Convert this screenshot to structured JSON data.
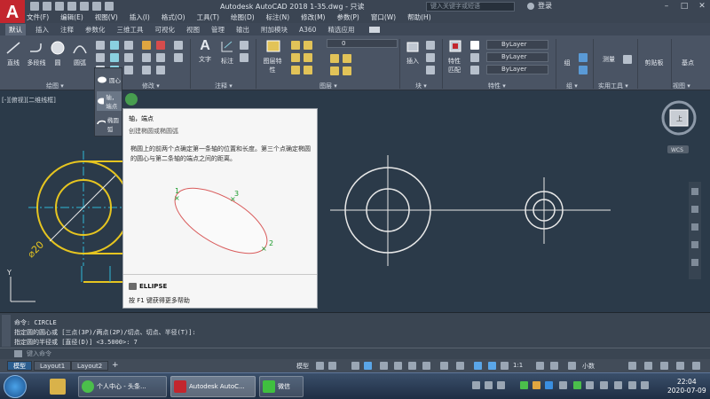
{
  "titlebar": {
    "title": "Autodesk AutoCAD 2018    1-35.dwg - 只读",
    "search_placeholder": "键入关键字或短语",
    "login_label": "登录"
  },
  "menubar": [
    "文件(F)",
    "编辑(E)",
    "视图(V)",
    "插入(I)",
    "格式(O)",
    "工具(T)",
    "绘图(D)",
    "标注(N)",
    "修改(M)",
    "参数(P)",
    "窗口(W)",
    "帮助(H)"
  ],
  "ribbon_tabs": [
    "默认",
    "插入",
    "注释",
    "参数化",
    "三维工具",
    "可视化",
    "视图",
    "管理",
    "输出",
    "附加模块",
    "A360",
    "精选应用"
  ],
  "ribbon": {
    "tools": {
      "line": "直线",
      "polyline": "多段线",
      "circle": "圆",
      "arc": "圆弧",
      "text": "文字",
      "dimension": "标注",
      "layer_props": "图层特性",
      "insert": "插入",
      "match_props": "特性匹配",
      "group": "组",
      "measure": "测量",
      "paste": "剪贴板",
      "base": "基点"
    },
    "panels": {
      "draw": "绘图 ▾",
      "modify": "修改 ▾",
      "annotation": "注释 ▾",
      "layers": "图层 ▾",
      "block": "块 ▾",
      "properties": "特性 ▾",
      "groups": "组 ▾",
      "utilities": "实用工具 ▾",
      "view": "视图 ▾"
    },
    "layer_value": "0",
    "bylayer": [
      "ByLayer",
      "ByLayer",
      "ByLayer"
    ]
  },
  "circle_dropdown": {
    "items": [
      "圆心",
      "轴，端点",
      "椭圆弧"
    ]
  },
  "viewport_label": "[-][俯视][二维线框]",
  "tooltip": {
    "title": "轴，端点",
    "subtitle": "创建椭圆或椭圆弧",
    "description": "椭圆上的前两个点确定第一条轴的位置和长度。第三个点确定椭圆的圆心与第二条轴的端点之间的距离。",
    "point_labels": [
      "1",
      "3",
      "2"
    ],
    "command": "ELLIPSE",
    "help": "按 F1 键获得更多帮助"
  },
  "drawing": {
    "dimension_label": "⌀20",
    "y_axis_label": "Y",
    "viewcube_label": "上",
    "wcs_label": "WCS"
  },
  "command_history": [
    "命令:  CIRCLE",
    "指定圆的圆心或 [三点(3P)/两点(2P)/切点、切点、半径(T)]:",
    "指定圆的半径或 [直径(D)] <3.5000>: 7"
  ],
  "command_prompt": "键入命令",
  "layout_tabs": [
    "模型",
    "Layout1",
    "Layout2"
  ],
  "status_bar": {
    "model_label": "模型",
    "scale": "1:1",
    "units": "小数"
  },
  "taskbar": {
    "items": [
      "个人中心 - 头条...",
      "Autodesk AutoC...",
      "微信"
    ],
    "time": "22:04",
    "date": "2020-07-09"
  },
  "colors": {
    "canvas": "#2b3a49",
    "geometry_yellow": "#e6c520",
    "geometry_white": "#e8e8e8",
    "center_cyan": "#2fb8d6",
    "ellipse_red": "#d95c5c",
    "tooltip_green": "#1a9a2a"
  }
}
